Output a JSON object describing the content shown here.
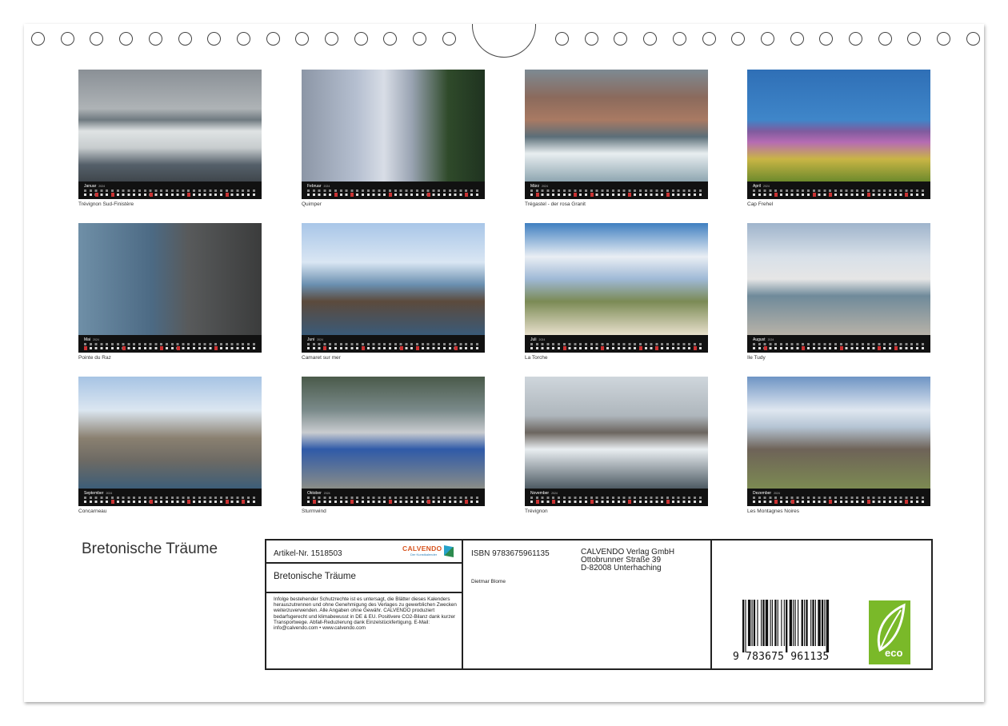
{
  "months": [
    {
      "name": "Januar",
      "year": "2024",
      "caption": "Trévignon Sud-Finistère"
    },
    {
      "name": "Februar",
      "year": "2024",
      "caption": "Quimper"
    },
    {
      "name": "März",
      "year": "2024",
      "caption": "Trégastel - der rosa Granit"
    },
    {
      "name": "April",
      "year": "2024",
      "caption": "Cap Frehel"
    },
    {
      "name": "Mai",
      "year": "2024",
      "caption": "Pointe du Raz"
    },
    {
      "name": "Juni",
      "year": "2024",
      "caption": "Camaret sur mer"
    },
    {
      "name": "Juli",
      "year": "2024",
      "caption": "La Torche"
    },
    {
      "name": "August",
      "year": "2024",
      "caption": "Ile Tudy"
    },
    {
      "name": "September",
      "year": "2024",
      "caption": "Concarneau"
    },
    {
      "name": "Oktober",
      "year": "2024",
      "caption": "Sturmwind"
    },
    {
      "name": "November",
      "year": "2024",
      "caption": "Trévignon"
    },
    {
      "name": "Dezember",
      "year": "2024",
      "caption": "Les Montagnes Noires"
    }
  ],
  "title": "Bretonische Träume",
  "info": {
    "article": "Artikel-Nr. 1518503",
    "product_title": "Bretonische Träume",
    "legal": "Infolge bestehender Schutzrechte ist es untersagt, die Blätter dieses Kalenders herauszutrennen und ohne Genehmigung des Verlages zu gewerblichen Zwecken weiterzuverwenden. Alle Angaben ohne Gewähr. CALVENDO produziert bedarfsgerecht und klimabewusst in DE & EU. Positivere CO2-Bilanz dank kurzer Transportwege. Abfall-Reduzierung dank Einzelstückfertigung. E-Mail: info@calvendo.com • www.calvendo.com",
    "isbn": "ISBN 9783675961135",
    "publisher_name": "CALVENDO Verlag GmbH",
    "publisher_street": "Ottobrunner Straße 39",
    "publisher_city": "D-82008 Unterhaching",
    "author": "Dietmar Blome",
    "barcode_text": "9 783675 961135",
    "logo_word": "CALVENDO",
    "logo_sub": "Der Kunstkalender",
    "eco_label": "eco"
  },
  "colors": {
    "calendar_bar": "#111111",
    "weekend": "#cc3333",
    "eco_green": "#7ab929",
    "logo_orange": "#d8541e"
  }
}
